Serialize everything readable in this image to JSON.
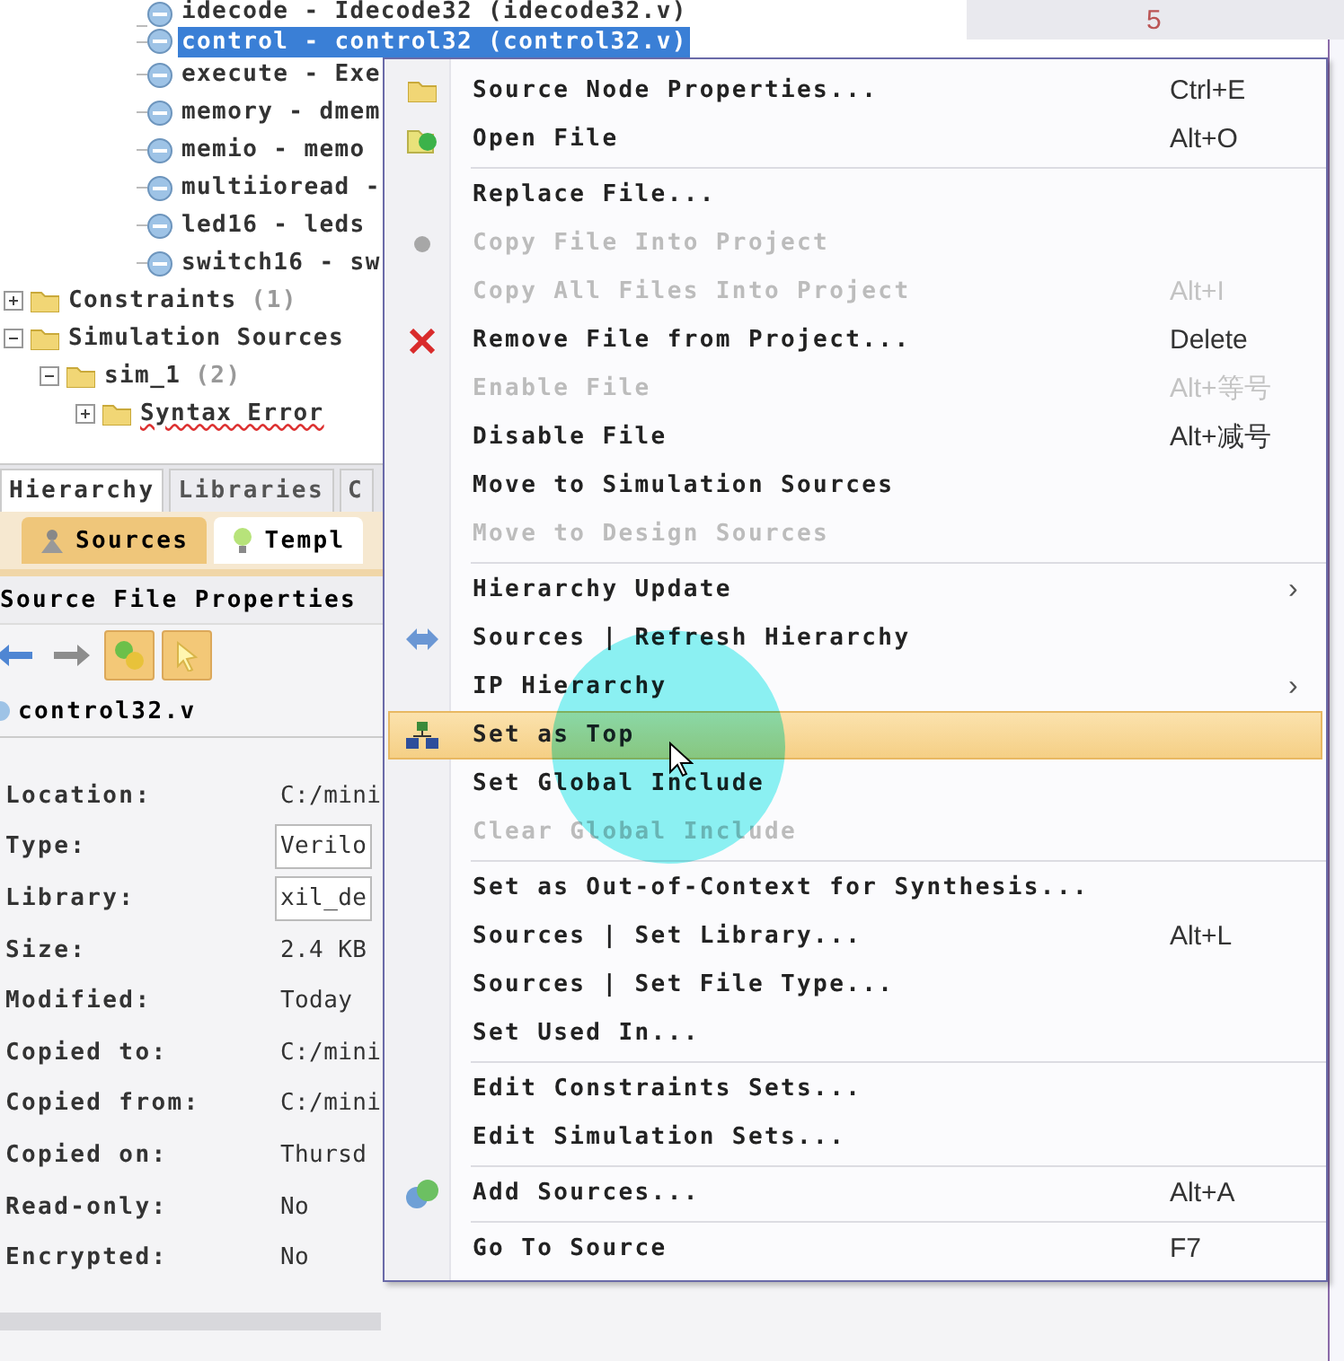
{
  "tree": {
    "modules": [
      {
        "label": "idecode - Idecode32 (idecode32.v)",
        "selected": false
      },
      {
        "label": "control - control32 (control32.v)",
        "selected": true
      },
      {
        "label": "execute - Exe",
        "selected": false
      },
      {
        "label": "memory - dmem",
        "selected": false
      },
      {
        "label": "memio - memo",
        "selected": false
      },
      {
        "label": "multiioread -",
        "selected": false
      },
      {
        "label": "led16 - leds",
        "selected": false
      },
      {
        "label": "switch16 - sw",
        "selected": false
      }
    ],
    "nodes": [
      {
        "label": "Constraints",
        "count": "(1)",
        "expanded": false
      },
      {
        "label": "Simulation Sources",
        "expanded": true,
        "children": [
          {
            "label": "sim_1",
            "count": "(2)",
            "expanded": true,
            "children": [
              {
                "label": "Syntax Error",
                "expanded": false,
                "error": true
              }
            ]
          }
        ]
      }
    ]
  },
  "tabs": [
    {
      "label": "Hierarchy",
      "selected": true
    },
    {
      "label": "Libraries",
      "selected": false
    },
    {
      "label": "C",
      "selected": false
    }
  ],
  "subtabs": [
    {
      "label": "Sources",
      "selected": true
    },
    {
      "label": "Templ",
      "selected": false
    }
  ],
  "properties": {
    "title": "Source File Properties",
    "file": "control32.v",
    "toolbar": [
      {
        "kind": "back",
        "selected": false
      },
      {
        "kind": "forward",
        "selected": false
      },
      {
        "kind": "link",
        "selected": true
      },
      {
        "kind": "pointer",
        "selected": true
      }
    ],
    "rows": [
      {
        "label": "Location:",
        "value": "C:/mini",
        "kind": "text"
      },
      {
        "label": "Type:",
        "value": "Verilo",
        "kind": "field"
      },
      {
        "label": "Library:",
        "value": "xil_de",
        "kind": "field"
      },
      {
        "label": "Size:",
        "value": "2.4 KB",
        "kind": "text"
      },
      {
        "label": "Modified:",
        "value": "Today",
        "kind": "text"
      },
      {
        "label": "Copied to:",
        "value": "C:/mini",
        "kind": "text"
      },
      {
        "label": "Copied from:",
        "value": "C:/mini",
        "kind": "text"
      },
      {
        "label": "Copied on:",
        "value": "Thursd",
        "kind": "text"
      },
      {
        "label": "Read-only:",
        "value": "No",
        "kind": "text"
      },
      {
        "label": "Encrypted:",
        "value": "No",
        "kind": "text"
      }
    ]
  },
  "right_panel": {
    "text": "5"
  },
  "context_menu": [
    {
      "kind": "item",
      "label": "Source Node Properties...",
      "shortcut": "Ctrl+E",
      "disabled": false,
      "selected": false
    },
    {
      "kind": "item",
      "label": "Open File",
      "shortcut": "Alt+O",
      "disabled": false,
      "selected": false
    },
    {
      "kind": "separator"
    },
    {
      "kind": "item",
      "label": "Replace File...",
      "disabled": false,
      "selected": false
    },
    {
      "kind": "item",
      "label": "Copy File Into Project",
      "disabled": true,
      "selected": false
    },
    {
      "kind": "item",
      "label": "Copy All Files Into Project",
      "shortcut": "Alt+I",
      "disabled": true,
      "selected": false
    },
    {
      "kind": "item",
      "label": "Remove File from Project...",
      "shortcut": "Delete",
      "disabled": false,
      "selected": false
    },
    {
      "kind": "item",
      "label": "Enable File",
      "shortcut": "Alt+等号",
      "disabled": true,
      "selected": false
    },
    {
      "kind": "item",
      "label": "Disable File",
      "shortcut": "Alt+减号",
      "disabled": false,
      "selected": false
    },
    {
      "kind": "item",
      "label": "Move to Simulation Sources",
      "disabled": false,
      "selected": false
    },
    {
      "kind": "item",
      "label": "Move to Design Sources",
      "disabled": true,
      "selected": false
    },
    {
      "kind": "separator"
    },
    {
      "kind": "item",
      "label": "Hierarchy Update",
      "submenu": "›",
      "disabled": false,
      "selected": false
    },
    {
      "kind": "item",
      "label": "Sources | Refresh Hierarchy",
      "disabled": false,
      "selected": false
    },
    {
      "kind": "item",
      "label": "IP Hierarchy",
      "submenu": "›",
      "disabled": false,
      "selected": false
    },
    {
      "kind": "item",
      "label": "Set as Top",
      "disabled": false,
      "selected": true
    },
    {
      "kind": "item",
      "label": "Set Global Include",
      "disabled": false,
      "selected": false
    },
    {
      "kind": "item",
      "label": "Clear Global Include",
      "disabled": true,
      "selected": false
    },
    {
      "kind": "separator"
    },
    {
      "kind": "item",
      "label": "Set as Out-of-Context for Synthesis...",
      "disabled": false,
      "selected": false
    },
    {
      "kind": "item",
      "label": "Sources | Set Library...",
      "shortcut": "Alt+L",
      "disabled": false,
      "selected": false
    },
    {
      "kind": "item",
      "label": "Sources | Set File Type...",
      "disabled": false,
      "selected": false
    },
    {
      "kind": "item",
      "label": "Set Used In...",
      "disabled": false,
      "selected": false
    },
    {
      "kind": "separator"
    },
    {
      "kind": "item",
      "label": "Edit Constraints Sets...",
      "disabled": false,
      "selected": false
    },
    {
      "kind": "item",
      "label": "Edit Simulation Sets...",
      "disabled": false,
      "selected": false
    },
    {
      "kind": "separator"
    },
    {
      "kind": "item",
      "label": "Add Sources...",
      "shortcut": "Alt+A",
      "disabled": false,
      "selected": false
    },
    {
      "kind": "separator"
    },
    {
      "kind": "item",
      "label": "Go To Source",
      "shortcut": "F7",
      "disabled": false,
      "selected": false
    }
  ]
}
